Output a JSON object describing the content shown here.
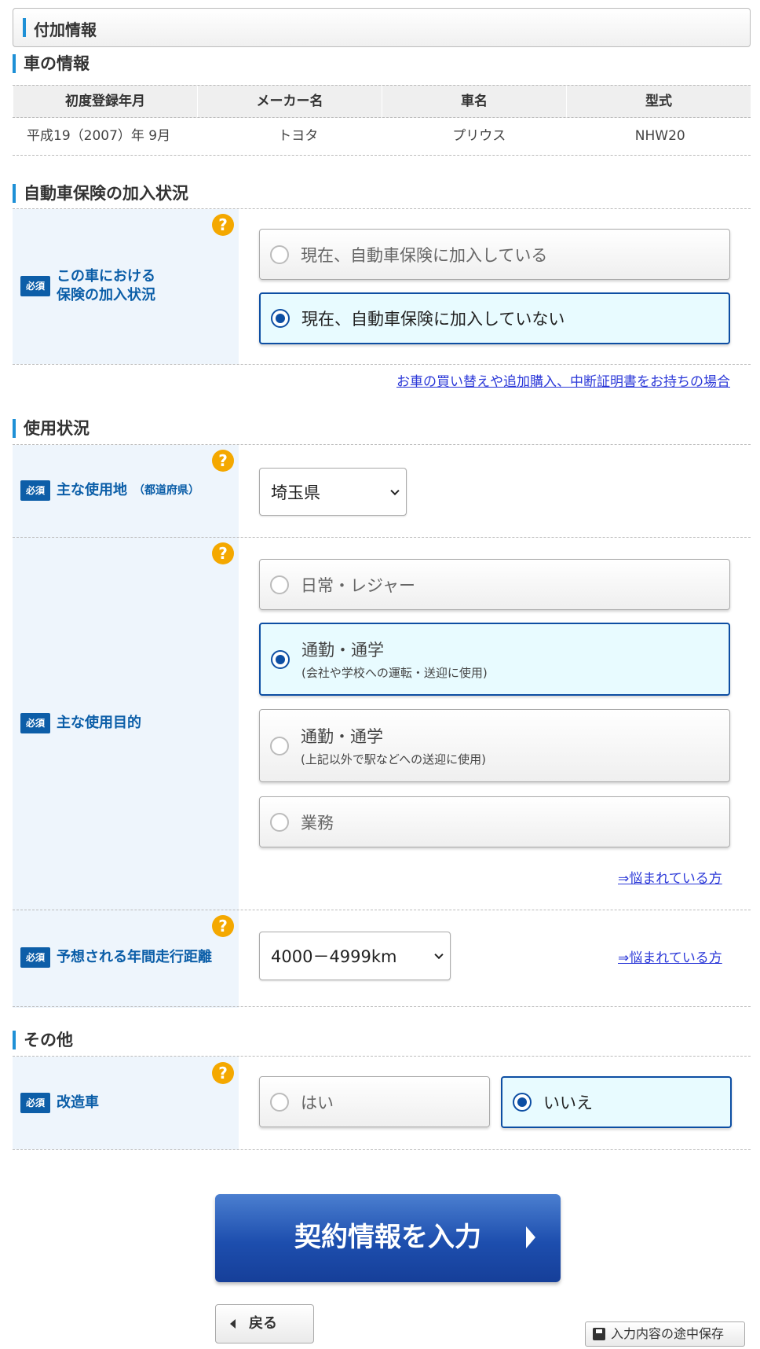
{
  "header": {
    "title": "付加情報"
  },
  "car_info": {
    "title": "車の情報",
    "columns": [
      "初度登録年月",
      "メーカー名",
      "車名",
      "型式"
    ],
    "row": [
      "平成19（2007）年 9月",
      "トヨタ",
      "プリウス",
      "NHW20"
    ]
  },
  "insurance": {
    "title": "自動車保険の加入状況",
    "required": "必須",
    "label_line1": "この車における",
    "label_line2": "保険の加入状況",
    "options": [
      "現在、自動車保険に加入している",
      "現在、自動車保険に加入していない"
    ],
    "selected_index": 1,
    "link": "お車の買い替えや追加購入、中断証明書をお持ちの場合"
  },
  "usage": {
    "title": "使用状況",
    "place_required": "必須",
    "place_label": "主な使用地",
    "place_sub": "（都道府県）",
    "place_value": "埼玉県",
    "purpose_required": "必須",
    "purpose_label": "主な使用目的",
    "purpose_options": [
      {
        "main": "日常・レジャー",
        "sub": ""
      },
      {
        "main": "通勤・通学",
        "sub": "(会社や学校への運転・送迎に使用)"
      },
      {
        "main": "通勤・通学",
        "sub": "(上記以外で駅などへの送迎に使用)"
      },
      {
        "main": "業務",
        "sub": ""
      }
    ],
    "purpose_selected_index": 1,
    "purpose_help_link": "⇒悩まれている方",
    "distance_required": "必須",
    "distance_label": "予想される年間走行距離",
    "distance_value": "4000－4999km",
    "distance_help_link": "⇒悩まれている方"
  },
  "other": {
    "title": "その他",
    "required": "必須",
    "label": "改造車",
    "options": [
      "はい",
      "いいえ"
    ],
    "selected_index": 1
  },
  "help_symbol": "?",
  "buttons": {
    "next": "契約情報を入力",
    "back": "戻る",
    "save": "入力内容の途中保存"
  },
  "colors": {
    "accent": "#1e90d6",
    "primary": "#0d4ea3",
    "help": "#f4a800"
  }
}
